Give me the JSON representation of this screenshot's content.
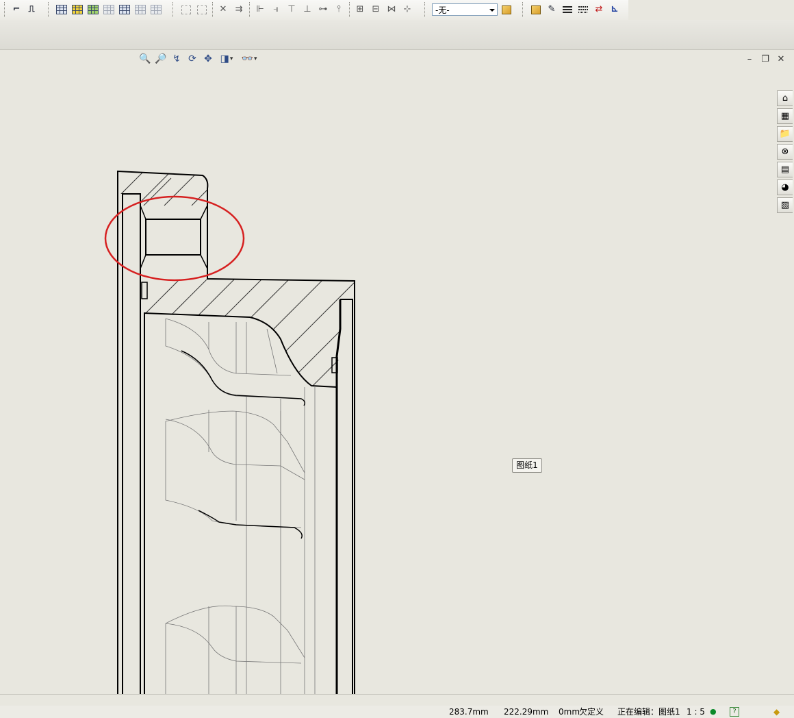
{
  "layer_dropdown": {
    "value": "-无-"
  },
  "sheet_tab": {
    "label": "图纸1"
  },
  "status": {
    "x_coord": "283.7mm",
    "y_coord": "222.29mm",
    "z_coord": "0mm",
    "constraint": "欠定义",
    "editing": "正在编辑：图纸1",
    "scale": "1 : 5"
  },
  "icons": {
    "toolbar": [
      "smart-dimension-icon",
      "step-line-icon",
      "table-icon",
      "bom-table-icon",
      "hole-table-icon",
      "revision-table-icon",
      "weld-table-icon",
      "general-table-icon",
      "align-grid-icon",
      "group-icon",
      "delete-icon",
      "align-right-icon",
      "align-left-icon",
      "align-right2-icon",
      "align-top-icon",
      "align-bottom-icon",
      "center-h-icon",
      "center-v-icon",
      "space-across-icon",
      "space-down-icon",
      "center-across-icon",
      "center-down-icon",
      "layer-properties-icon",
      "color-icon",
      "line-color-icon",
      "line-thickness-icon",
      "line-style-icon",
      "hide-show-edges-icon",
      "line-format-icon"
    ],
    "view": [
      "zoom-to-fit-icon",
      "zoom-area-icon",
      "previous-view-icon",
      "rotate-icon",
      "pan-icon",
      "display-style-icon",
      "hide-show-icon"
    ],
    "taskpane": [
      "home-icon",
      "design-library-icon",
      "file-explorer-icon",
      "view-palette-icon",
      "appearance-icon",
      "custom-properties-icon",
      "properties-icon"
    ]
  },
  "colors": {
    "annotation_ring": "#d62020",
    "canvas": "#e8e7df"
  }
}
